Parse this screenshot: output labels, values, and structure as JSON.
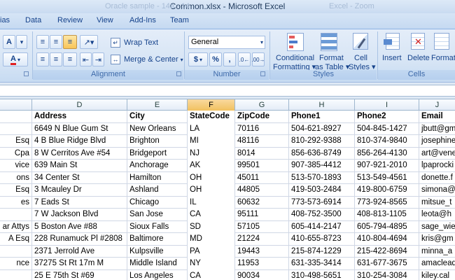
{
  "window": {
    "title": "Common.xlsx - Microsoft Excel",
    "ghost_title_left": "Oracle sample - 14a - 14",
    "ghost_title_right": "Excel - Zoom"
  },
  "tabs": [
    "ias",
    "Data",
    "Review",
    "View",
    "Add-Ins",
    "Team"
  ],
  "ribbon": {
    "alignment": {
      "wrap_text": "Wrap Text",
      "merge_center": "Merge & Center",
      "label": "Alignment"
    },
    "number": {
      "format": "General",
      "currency": "$",
      "percent": "%",
      "comma": ",",
      "label": "Number"
    },
    "styles": {
      "conditional": "Conditional",
      "conditional2": "Formatting",
      "format_table": "Format",
      "format_table2": "as Table",
      "cell_styles": "Cell",
      "cell_styles2": "Styles",
      "label": "Styles"
    },
    "cells": {
      "insert": "Insert",
      "delete": "Delete",
      "format": "Format",
      "label": "Cells"
    },
    "font": {
      "grow_icon": "A",
      "color_icon": "A"
    }
  },
  "columns": [
    "D",
    "E",
    "F",
    "G",
    "H",
    "I",
    "J"
  ],
  "selected_column": "F",
  "table": {
    "headers": [
      "Address",
      "City",
      "StateCode",
      "ZipCode",
      "Phone1",
      "Phone2",
      "Email"
    ],
    "rows": [
      {
        "c": "",
        "address": "6649 N Blue Gum St",
        "city": "New Orleans",
        "state": "LA",
        "zip": "70116",
        "phone1": "504-621-8927",
        "phone2": "504-845-1427",
        "email": "jbutt@gm"
      },
      {
        "c": "Esq",
        "address": "4 B Blue Ridge Blvd",
        "city": "Brighton",
        "state": "MI",
        "zip": "48116",
        "phone1": "810-292-9388",
        "phone2": "810-374-9840",
        "email": "josephine"
      },
      {
        "c": "Cpa",
        "address": "8 W Cerritos Ave #54",
        "city": "Bridgeport",
        "state": "NJ",
        "zip": "8014",
        "phone1": "856-636-8749",
        "phone2": "856-264-4130",
        "email": "art@vene"
      },
      {
        "c": "vice",
        "address": "639 Main St",
        "city": "Anchorage",
        "state": "AK",
        "zip": "99501",
        "phone1": "907-385-4412",
        "phone2": "907-921-2010",
        "email": "lpaprocki"
      },
      {
        "c": "ons",
        "address": "34 Center St",
        "city": "Hamilton",
        "state": "OH",
        "zip": "45011",
        "phone1": "513-570-1893",
        "phone2": "513-549-4561",
        "email": "donette.f"
      },
      {
        "c": "Esq",
        "address": "3 Mcauley Dr",
        "city": "Ashland",
        "state": "OH",
        "zip": "44805",
        "phone1": "419-503-2484",
        "phone2": "419-800-6759",
        "email": "simona@"
      },
      {
        "c": "es",
        "address": "7 Eads St",
        "city": "Chicago",
        "state": "IL",
        "zip": "60632",
        "phone1": "773-573-6914",
        "phone2": "773-924-8565",
        "email": "mitsue_t"
      },
      {
        "c": "",
        "address": "7 W Jackson Blvd",
        "city": "San Jose",
        "state": "CA",
        "zip": "95111",
        "phone1": "408-752-3500",
        "phone2": "408-813-1105",
        "email": "leota@h"
      },
      {
        "c": "ar Attys",
        "address": "5 Boston Ave #88",
        "city": "Sioux Falls",
        "state": "SD",
        "zip": "57105",
        "phone1": "605-414-2147",
        "phone2": "605-794-4895",
        "email": "sage_wie"
      },
      {
        "c": "A Esq",
        "address": "228 Runamuck Pl #2808",
        "city": "Baltimore",
        "state": "MD",
        "zip": "21224",
        "phone1": "410-655-8723",
        "phone2": "410-804-4694",
        "email": "kris@gm"
      },
      {
        "c": "",
        "address": "2371 Jerrold Ave",
        "city": "Kulpsville",
        "state": "PA",
        "zip": "19443",
        "phone1": "215-874-1229",
        "phone2": "215-422-8694",
        "email": "minna_a"
      },
      {
        "c": "nce",
        "address": "37275 St  Rt 17m M",
        "city": "Middle Island",
        "state": "NY",
        "zip": "11953",
        "phone1": "631-335-3414",
        "phone2": "631-677-3675",
        "email": "amaclead"
      },
      {
        "c": "",
        "address": "25 E 75th St #69",
        "city": "Los Angeles",
        "state": "CA",
        "zip": "90034",
        "phone1": "310-498-5651",
        "phone2": "310-254-3084",
        "email": "kiley.cal"
      }
    ]
  }
}
